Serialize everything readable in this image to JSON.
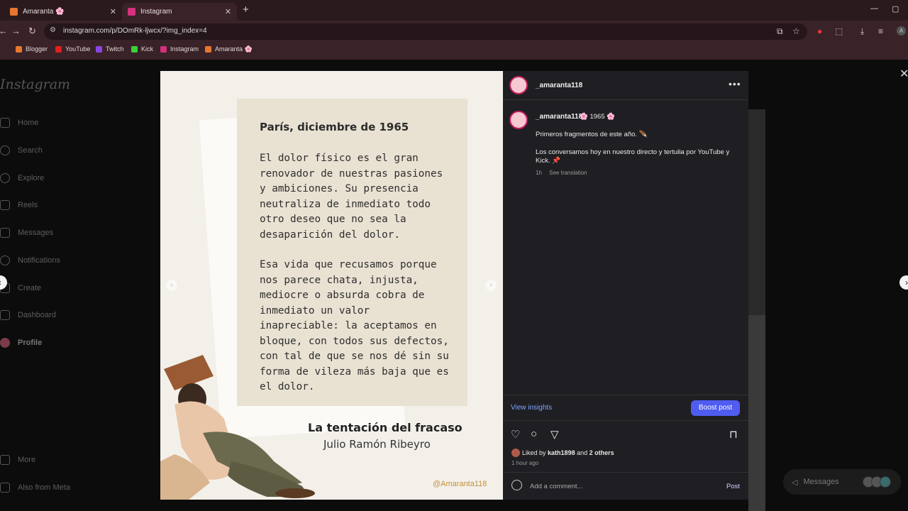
{
  "browser": {
    "tabs": [
      {
        "title": "Amaranta 🌸",
        "close": "✕"
      },
      {
        "title": "Instagram",
        "close": "✕"
      }
    ],
    "new_tab": "+",
    "window_controls": [
      "—",
      "▢"
    ],
    "url": "instagram.com/p/DOmRk-ljwcx/?img_index=4",
    "bookmarks": [
      "Blogger",
      "YouTube",
      "Twitch",
      "Kick",
      "Instagram",
      "Amaranta 🌸"
    ]
  },
  "instagram": {
    "logo": "Instagram",
    "nav": [
      "Home",
      "Search",
      "Explore",
      "Reels",
      "Messages",
      "Notifications",
      "Create",
      "Dashboard",
      "Profile"
    ],
    "more": "More",
    "also_from_meta": "Also from Meta",
    "messages_pill": "Messages"
  },
  "post_image": {
    "title": "París, diciembre de 1965",
    "para1": "El dolor físico es el gran\nrenovador de nuestras pasiones\ny ambiciones. Su presencia\nneutraliza de inmediato todo\notro deseo que no sea la\ndesaparición del dolor.",
    "para2": "Esa vida que recusamos porque\nnos parece chata, injusta,\nmediocre o absurda cobra de\ninmediato un valor\ninapreciable: la aceptamos en\nbloque, con todos sus defectos,\ncon tal de que se nos dé sin su\nforma de vileza más baja que es\nel dolor.",
    "book_title": "La tentación del fracaso",
    "book_author": "Julio Ramón Ribeyro",
    "handle": "@Amaranta118"
  },
  "post_panel": {
    "username": "_amaranta118",
    "caption_header": "🌸 1965 🌸",
    "caption_line1": "Primeros fragmentos de este año. 🪶",
    "caption_line2": "Los conversamos hoy en nuestro directo y tertulia por YouTube y Kick. 📌",
    "time": "1h",
    "see_translation": "See translation",
    "view_insights": "View insights",
    "boost_post": "Boost post",
    "liked_by": "Liked by",
    "liked_user": "kath1898",
    "liked_and": "and",
    "liked_others": "2 others",
    "ago": "1 hour ago",
    "comment_placeholder": "Add a comment...",
    "post": "Post"
  }
}
